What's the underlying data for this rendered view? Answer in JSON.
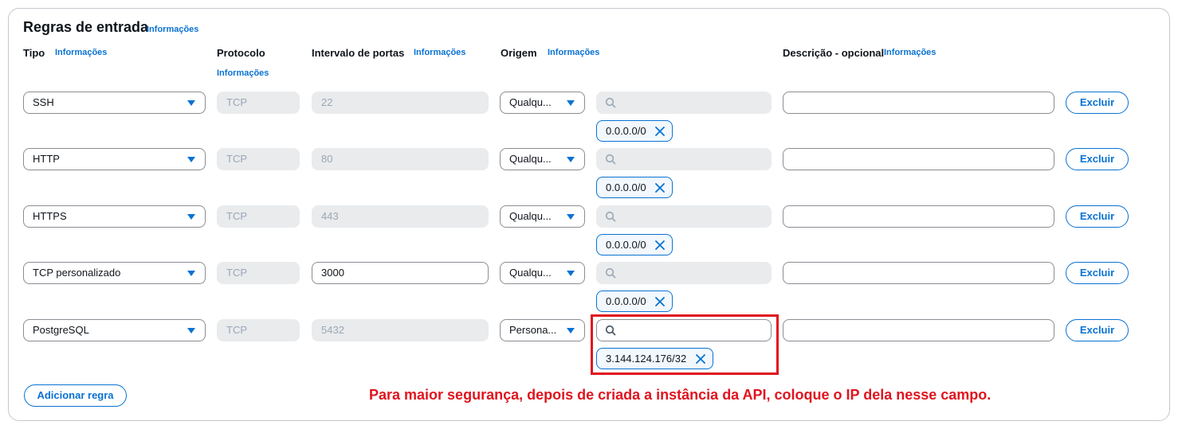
{
  "section": {
    "title": "Regras de entrada",
    "info_link": "Informações"
  },
  "headers": {
    "type": "Tipo",
    "protocol": "Protocolo",
    "port_range": "Intervalo de portas",
    "source": "Origem",
    "description": "Descrição - opcional",
    "info_link": "Informações"
  },
  "rules": [
    {
      "type": "SSH",
      "protocol": "TCP",
      "port": "22",
      "source": "Qualqu...",
      "search_placeholder": "",
      "token": "0.0.0.0/0",
      "description": "",
      "delete_label": "Excluir"
    },
    {
      "type": "HTTP",
      "protocol": "TCP",
      "port": "80",
      "source": "Qualqu...",
      "search_placeholder": "",
      "token": "0.0.0.0/0",
      "description": "",
      "delete_label": "Excluir"
    },
    {
      "type": "HTTPS",
      "protocol": "TCP",
      "port": "443",
      "source": "Qualqu...",
      "search_placeholder": "",
      "token": "0.0.0.0/0",
      "description": "",
      "delete_label": "Excluir"
    },
    {
      "type": "TCP personalizado",
      "protocol": "TCP",
      "port": "3000",
      "source": "Qualqu...",
      "search_placeholder": "",
      "token": "0.0.0.0/0",
      "description": "",
      "delete_label": "Excluir"
    },
    {
      "type": "PostgreSQL",
      "protocol": "TCP",
      "port": "5432",
      "source": "Persona...",
      "search_placeholder": "",
      "token": "3.144.124.176/32",
      "description": "",
      "delete_label": "Excluir"
    }
  ],
  "add_rule_label": "Adicionar regra",
  "annotation": "Para maior segurança, depois de criada a instância da API, coloque o IP dela nesse campo.",
  "colors": {
    "accent": "#0972d3",
    "annotation": "#e0141e",
    "disabled_bg": "#e9ebed"
  }
}
